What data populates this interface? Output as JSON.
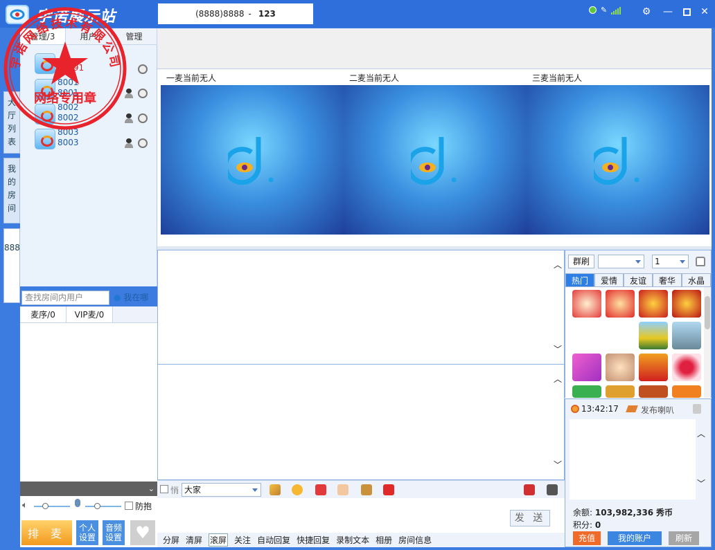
{
  "app": {
    "title": "宇诺展示站",
    "room_code": "(8888)8888",
    "separator": "-",
    "room_number": "123"
  },
  "stamp": {
    "top_text": "宇诺网络技术有限公司",
    "bottom_text": "网络专用章"
  },
  "left_tabs": [
    {
      "label": "大厅列表"
    },
    {
      "label": "我的房间"
    },
    {
      "label": "8888"
    }
  ],
  "user_tabs": [
    {
      "label": "管理/3"
    },
    {
      "label": "用户"
    },
    {
      "label": "管理"
    }
  ],
  "users": [
    {
      "name": "12691",
      "id": ""
    },
    {
      "name": "8001",
      "id": "8001"
    },
    {
      "name": "8002",
      "id": "8002"
    },
    {
      "name": "8003",
      "id": "8003"
    }
  ],
  "search": {
    "placeholder": "查找房间内用户",
    "where_label": "我在哪"
  },
  "mic_tabs": [
    {
      "label": "麦序/0"
    },
    {
      "label": "VIP麦/0"
    }
  ],
  "controls": {
    "anti_hug": "防抱",
    "queue_btn": "排 麦",
    "personal_settings": "个人设置",
    "audio_settings": "音频设置"
  },
  "video_slots": [
    {
      "label": "一麦当前无人"
    },
    {
      "label": "二麦当前无人"
    },
    {
      "label": "三麦当前无人"
    }
  ],
  "toolbar": {
    "whisper": "悄",
    "recipient": "大家"
  },
  "send_label": "发 送",
  "bottom_links": [
    "分屏",
    "清屏",
    "滚屏",
    "关注",
    "自动回复",
    "快捷回复",
    "录制文本",
    "相册",
    "房间信息"
  ],
  "gift_panel": {
    "mass_btn": "群刷",
    "count": "1",
    "tabs": [
      "热门",
      "爱情",
      "友谊",
      "奢华",
      "水晶"
    ]
  },
  "speaker": {
    "time": "13:42:17",
    "publish": "发布喇叭"
  },
  "account": {
    "balance_label": "余额:",
    "balance": "103,982,336",
    "balance_unit": "秀币",
    "points_label": "积分:",
    "points": "0",
    "recharge": "充值",
    "my_account": "我的账户",
    "refresh": "刷新"
  },
  "colors": {
    "titlebar": "#2f6fdc",
    "accent": "#2d7fe6",
    "stamp_red": "#e8232b",
    "recharge": "#f06a2a"
  }
}
